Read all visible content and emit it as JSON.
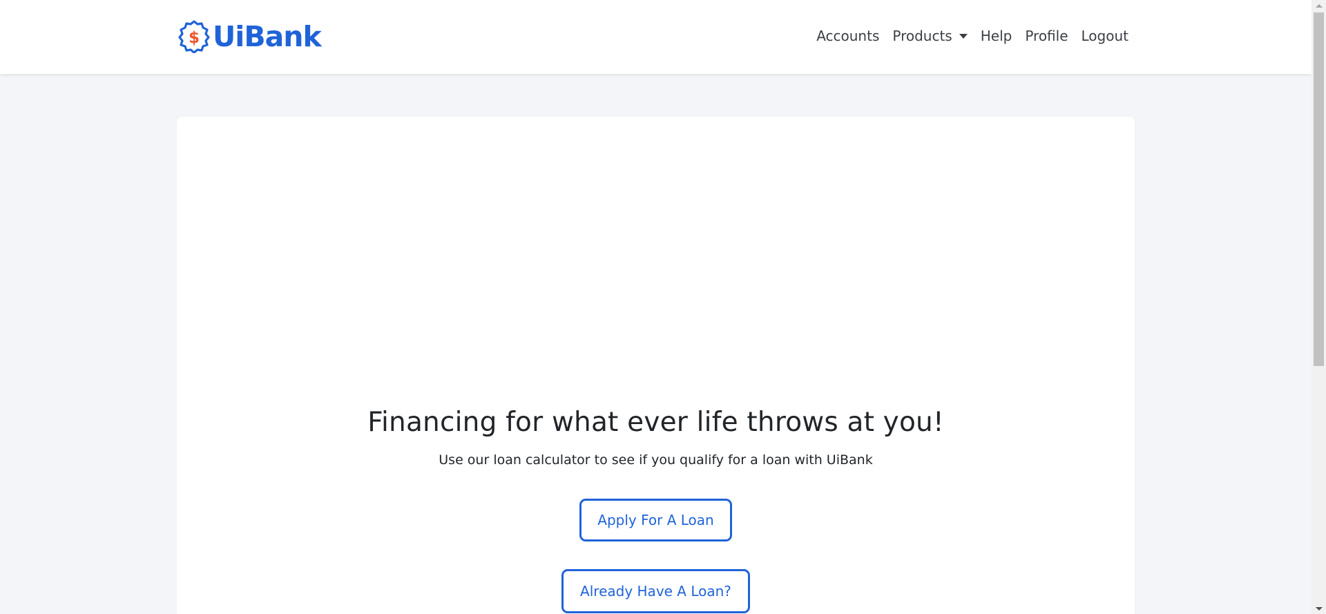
{
  "brand": {
    "name": "UiBank",
    "logo_icon": "dollar-badge-icon",
    "primary_color": "#1f63d8",
    "accent_color": "#f0542d"
  },
  "nav": {
    "accounts": "Accounts",
    "products": "Products",
    "help": "Help",
    "profile": "Profile",
    "logout": "Logout"
  },
  "hero": {
    "title": "Financing for what ever life throws at you!",
    "subtitle": "Use our loan calculator to see if you qualify for a loan with UiBank",
    "apply_button": "Apply For A Loan",
    "existing_button": "Already Have A Loan?"
  }
}
